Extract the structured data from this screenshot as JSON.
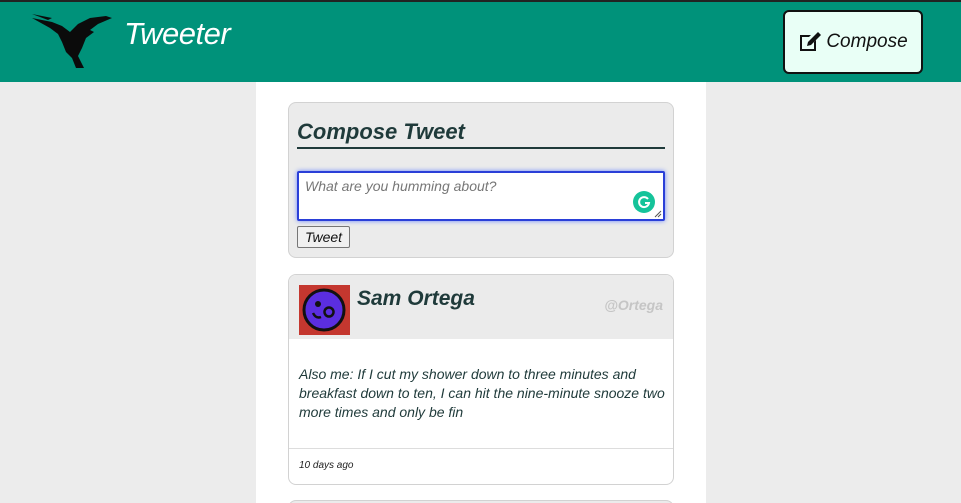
{
  "header": {
    "brand": "Tweeter",
    "compose_label": "Compose",
    "logo_icon": "hummingbird-icon",
    "compose_icon": "edit-icon",
    "bg_color": "#00927a"
  },
  "compose": {
    "title": "Compose Tweet",
    "placeholder": "What are you humming about?",
    "value": "",
    "submit_label": "Tweet",
    "assistant_icon": "grammarly-icon"
  },
  "tweets": [
    {
      "name": "Sam Ortega",
      "handle": "@Ortega",
      "body": "Also me: If I cut my shower down to three minutes and breakfast down to ten, I can hit the nine-minute snooze two more times and only be fin",
      "time": "10 days ago",
      "avatar_icon": "avatar-face-icon"
    }
  ]
}
